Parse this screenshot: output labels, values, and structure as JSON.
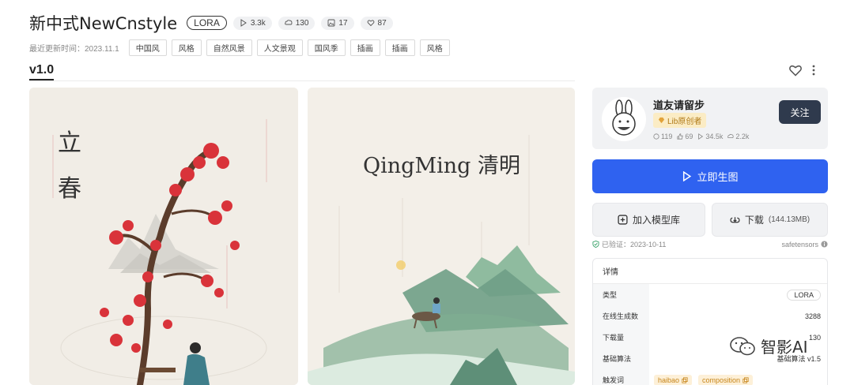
{
  "model": {
    "title": "新中式NewCnstyle",
    "type_badge": "LORA",
    "stats": {
      "runs": "3.3k",
      "downloads": "130",
      "images": "17",
      "likes": "87"
    },
    "update_label": "最近更新时间：2023.11.1",
    "tags": [
      "中国风",
      "风格",
      "自然风景",
      "人文景观",
      "国风季",
      "插画",
      "插画",
      "风格"
    ],
    "version": "v1.0"
  },
  "gallery": {
    "image1_text": {
      "line1": "立",
      "line2": "春"
    },
    "image2_text": "QingMing 清明"
  },
  "author": {
    "name": "道友请留步",
    "badge": "Lib原创者",
    "stats": {
      "a": "119",
      "b": "69",
      "c": "34.5k",
      "d": "2.2k"
    },
    "follow_label": "关注"
  },
  "actions": {
    "generate_label": "立即生图",
    "add_label": "加入模型库",
    "download_label": "下载",
    "download_size": "(144.13MB)"
  },
  "verify": {
    "verified_label": "已验证：2023-10-11",
    "format": "safetensors"
  },
  "details": {
    "header": "详情",
    "rows": [
      {
        "key": "类型",
        "value": "LORA"
      },
      {
        "key": "在线生成数",
        "value": "3288"
      },
      {
        "key": "下载量",
        "value": "130"
      },
      {
        "key": "基础算法",
        "value": "基础算法 v1.5"
      },
      {
        "key": "触发词",
        "value": ""
      }
    ],
    "triggers": [
      "haibao",
      "composition"
    ]
  },
  "watermark": {
    "text": "智影AI"
  },
  "colors": {
    "primary": "#2f62f0",
    "follow_bg": "#2f3a4d",
    "creator_badge_bg": "#fbecc5",
    "blossom": "#d9333a"
  }
}
